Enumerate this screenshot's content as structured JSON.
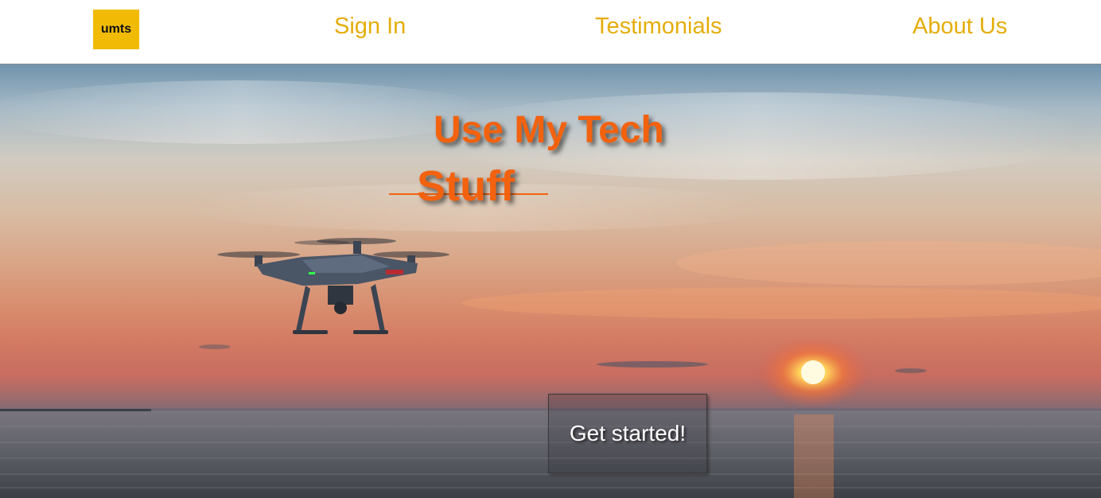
{
  "nav": {
    "logo_text": "umts",
    "links": [
      {
        "label": "Sign In"
      },
      {
        "label": "Testimonials"
      },
      {
        "label": "About Us"
      }
    ],
    "accent_color": "#e5ad09",
    "logo_color": "#f1bb05"
  },
  "hero": {
    "title_line1": "Use My Tech",
    "title_line2": "Stuff",
    "title_color": "#f2620f",
    "cta_label": "Get started!",
    "background_image": "drone-over-ocean-sunset"
  }
}
